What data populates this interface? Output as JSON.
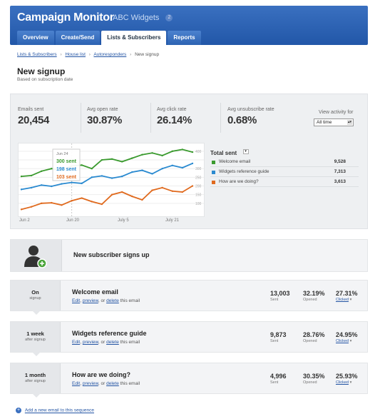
{
  "header": {
    "app_title": "Campaign Monitor",
    "client_name": "ABC Widgets",
    "client_badge": "2",
    "tabs": [
      {
        "label": "Overview"
      },
      {
        "label": "Create/Send"
      },
      {
        "label": "Lists & Subscribers"
      },
      {
        "label": "Reports"
      }
    ],
    "accent": "#2a5fae"
  },
  "breadcrumb": {
    "items": [
      "Lists & Subscribers",
      "House list",
      "Autoresponders"
    ],
    "current": "New signup",
    "separator": "›"
  },
  "page": {
    "title": "New signup",
    "subtitle": "Based on subscription date"
  },
  "stats": {
    "emails_sent_label": "Emails sent",
    "emails_sent": "20,454",
    "open_rate_label": "Avg open rate",
    "open_rate": "30.87%",
    "click_rate_label": "Avg click rate",
    "click_rate": "26.14%",
    "unsub_rate_label": "Avg unsubscribe rate",
    "unsub_rate": "0.68%",
    "view_activity_label": "View activity for",
    "view_activity_value": "All time"
  },
  "chart_data": {
    "type": "line",
    "x": [
      "Jun 2",
      "Jun 20",
      "July 5",
      "July 21"
    ],
    "series": [
      {
        "name": "Welcome email",
        "color": "#3a9a2e",
        "values": [
          255,
          260,
          285,
          300,
          290,
          315,
          320,
          300,
          350,
          355,
          340,
          360,
          380,
          390,
          375,
          400,
          410,
          395
        ]
      },
      {
        "name": "Widgets reference guide",
        "color": "#2a8ad0",
        "values": [
          180,
          190,
          205,
          198,
          212,
          220,
          215,
          250,
          258,
          245,
          255,
          280,
          290,
          270,
          300,
          318,
          305,
          330
        ]
      },
      {
        "name": "How are we doing?",
        "color": "#e06a1e",
        "values": [
          65,
          80,
          100,
          103,
          90,
          115,
          130,
          110,
          95,
          150,
          165,
          140,
          120,
          175,
          190,
          170,
          165,
          200
        ]
      }
    ],
    "y_ticks": [
      "400",
      "300",
      "250",
      "200",
      "150",
      "100"
    ],
    "ylim": [
      50,
      420
    ],
    "tooltip": {
      "date": "Jun 24",
      "lines": [
        "300 sent",
        "198 sent",
        "103 sent"
      ]
    },
    "legend": {
      "title": "Total sent",
      "entries": [
        {
          "name": "Welcome email",
          "value": "9,528",
          "color": "#3a9a2e"
        },
        {
          "name": "Widgets reference guide",
          "value": "7,313",
          "color": "#2a8ad0"
        },
        {
          "name": "How are we doing?",
          "value": "3,613",
          "color": "#e06a1e"
        }
      ]
    },
    "grid": true
  },
  "trigger": {
    "label": "New subscriber signs up"
  },
  "steps": [
    {
      "when": "On",
      "when_sub": "signup",
      "name": "Welcome email",
      "sent": "13,003",
      "sent_label": "Sent",
      "opened": "32.19%",
      "opened_label": "Opened",
      "clicked": "27.31%",
      "clicked_label": "Clicked"
    },
    {
      "when": "1 week",
      "when_sub": "after signup",
      "name": "Widgets reference guide",
      "sent": "9,873",
      "sent_label": "Sent",
      "opened": "28.76%",
      "opened_label": "Opened",
      "clicked": "24.95%",
      "clicked_label": "Clicked"
    },
    {
      "when": "1 month",
      "when_sub": "after signup",
      "name": "How are we doing?",
      "sent": "4,996",
      "sent_label": "Sent",
      "opened": "30.35%",
      "opened_label": "Opened",
      "clicked": "25.93%",
      "clicked_label": "Clicked"
    }
  ],
  "step_links": {
    "edit": "Edit",
    "comma": ",",
    "preview": "preview",
    "or": ", or",
    "delete": "delete",
    "tail": "this email"
  },
  "add_email": {
    "plus": "+",
    "label": "Add a new email to this sequence"
  }
}
